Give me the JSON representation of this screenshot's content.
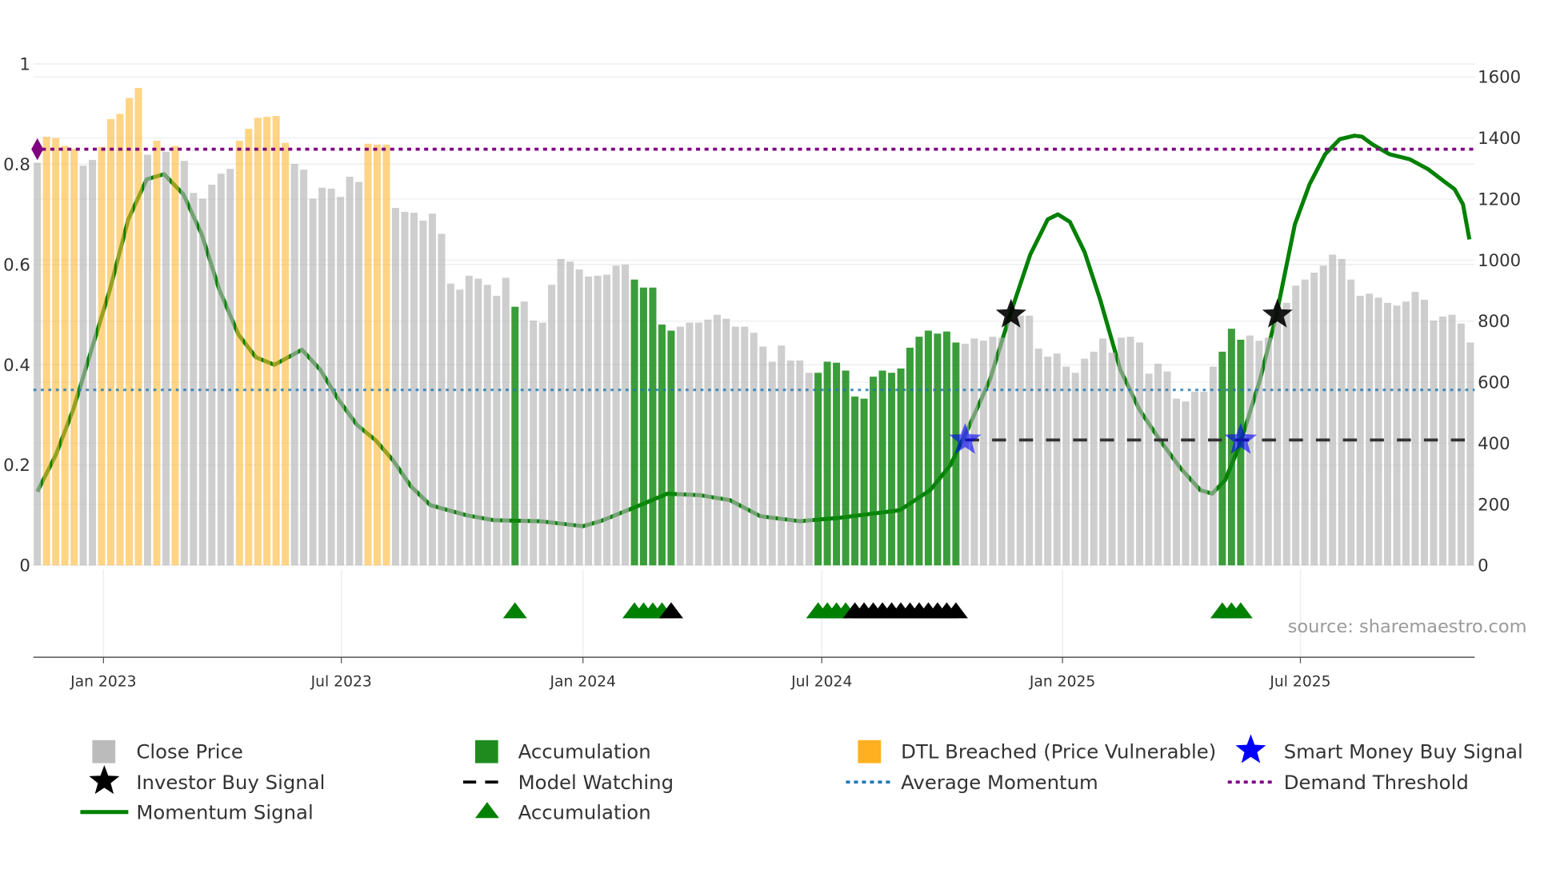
{
  "chart_data": {
    "type": "bar",
    "title": "",
    "left_axis": {
      "label": "",
      "range": [
        0,
        1
      ],
      "ticks": [
        "0",
        "0.2",
        "0.4",
        "0.6",
        "0.8",
        "1"
      ],
      "tick_values": [
        0,
        0.2,
        0.4,
        0.6,
        0.8,
        1
      ]
    },
    "right_axis": {
      "label": "",
      "range": [
        0,
        1600
      ],
      "ticks": [
        "0",
        "200",
        "400",
        "600",
        "800",
        "1000",
        "1200",
        "1400",
        "1600"
      ],
      "tick_values": [
        0,
        200,
        400,
        600,
        800,
        1000,
        1200,
        1400,
        1600
      ]
    },
    "x_axis": {
      "unit": "week index",
      "ticks": [
        {
          "label": "Jan 2023",
          "week": 7.2
        },
        {
          "label": "Jul 2023",
          "week": 33.1
        },
        {
          "label": "Jan 2024",
          "week": 59.4
        },
        {
          "label": "Jul 2024",
          "week": 85.4
        },
        {
          "label": "Jan 2025",
          "week": 111.6
        },
        {
          "label": "Jul 2025",
          "week": 137.5
        }
      ]
    },
    "close_price": [
      1319,
      1404,
      1400,
      1374,
      1364,
      1309,
      1328,
      1371,
      1462,
      1479,
      1531,
      1564,
      1345,
      1391,
      1355,
      1374,
      1325,
      1220,
      1201,
      1247,
      1283,
      1299,
      1391,
      1430,
      1466,
      1469,
      1472,
      1384,
      1315,
      1296,
      1201,
      1237,
      1234,
      1207,
      1273,
      1256,
      1381,
      1378,
      1378,
      1171,
      1158,
      1155,
      1129,
      1152,
      1086,
      923,
      903,
      949,
      939,
      919,
      883,
      942,
      847,
      864,
      802,
      795,
      919,
      1004,
      995,
      969,
      946,
      949,
      952,
      982,
      985,
      936,
      910,
      910,
      789,
      769,
      782,
      795,
      795,
      805,
      821,
      808,
      782,
      782,
      762,
      717,
      667,
      720,
      671,
      671,
      631,
      631,
      667,
      664,
      638,
      553,
      546,
      618,
      638,
      631,
      645,
      713,
      749,
      769,
      759,
      766,
      730,
      726,
      743,
      736,
      749,
      746,
      808,
      818,
      818,
      710,
      684,
      694,
      651,
      631,
      677,
      700,
      743,
      697,
      746,
      749,
      730,
      628,
      661,
      635,
      546,
      537,
      569,
      569,
      651,
      700,
      775,
      739,
      753,
      736,
      746,
      851,
      860,
      916,
      936,
      959,
      982,
      1018,
      1004,
      936,
      883,
      890,
      877,
      860,
      851,
      864,
      896,
      870,
      802,
      815,
      821,
      792,
      730
    ],
    "bar_state_runs": [
      [
        "C",
        1
      ],
      [
        "D",
        4
      ],
      [
        "C",
        2
      ],
      [
        "D",
        5
      ],
      [
        "C",
        1
      ],
      [
        "D",
        1
      ],
      [
        "C",
        1
      ],
      [
        "D",
        1
      ],
      [
        "C",
        6
      ],
      [
        "D",
        6
      ],
      [
        "C",
        8
      ],
      [
        "D",
        3
      ],
      [
        "C",
        13
      ],
      [
        "A",
        1
      ],
      [
        "C",
        12
      ],
      [
        "A",
        5
      ],
      [
        "C",
        15
      ],
      [
        "A",
        16
      ],
      [
        "C",
        28
      ],
      [
        "A",
        3
      ],
      [
        "C",
        25
      ]
    ],
    "momentum": [
      [
        0,
        0.147
      ],
      [
        2,
        0.22
      ],
      [
        3.9,
        0.31
      ],
      [
        5.9,
        0.43
      ],
      [
        7.9,
        0.55
      ],
      [
        9.9,
        0.69
      ],
      [
        11.9,
        0.77
      ],
      [
        13.8,
        0.78
      ],
      [
        15.9,
        0.74
      ],
      [
        17.9,
        0.66
      ],
      [
        19.8,
        0.55
      ],
      [
        21.9,
        0.46
      ],
      [
        23.8,
        0.415
      ],
      [
        25.8,
        0.4
      ],
      [
        27.8,
        0.42
      ],
      [
        28.8,
        0.43
      ],
      [
        30.8,
        0.39
      ],
      [
        32.8,
        0.33
      ],
      [
        34.8,
        0.28
      ],
      [
        36.8,
        0.25
      ],
      [
        38.7,
        0.21
      ],
      [
        40.7,
        0.157
      ],
      [
        42.8,
        0.12
      ],
      [
        46.7,
        0.1
      ],
      [
        49.7,
        0.09
      ],
      [
        54.7,
        0.088
      ],
      [
        59.4,
        0.078
      ],
      [
        61.3,
        0.088
      ],
      [
        65.6,
        0.12
      ],
      [
        68.6,
        0.143
      ],
      [
        72.1,
        0.14
      ],
      [
        75.4,
        0.13
      ],
      [
        78.7,
        0.098
      ],
      [
        83,
        0.088
      ],
      [
        87.4,
        0.095
      ],
      [
        93.9,
        0.11
      ],
      [
        97.2,
        0.15
      ],
      [
        99.4,
        0.2
      ],
      [
        101.5,
        0.28
      ],
      [
        103.7,
        0.37
      ],
      [
        105.9,
        0.5
      ],
      [
        108.1,
        0.62
      ],
      [
        110,
        0.69
      ],
      [
        111.1,
        0.7
      ],
      [
        112.4,
        0.685
      ],
      [
        114,
        0.625
      ],
      [
        115.7,
        0.53
      ],
      [
        117.9,
        0.39
      ],
      [
        120,
        0.31
      ],
      [
        122.2,
        0.25
      ],
      [
        124.4,
        0.195
      ],
      [
        126.6,
        0.15
      ],
      [
        127.9,
        0.143
      ],
      [
        129.3,
        0.17
      ],
      [
        130.9,
        0.24
      ],
      [
        133.1,
        0.37
      ],
      [
        134.9,
        0.5
      ],
      [
        136.9,
        0.68
      ],
      [
        138.5,
        0.76
      ],
      [
        140.2,
        0.82
      ],
      [
        141.8,
        0.85
      ],
      [
        143.4,
        0.857
      ],
      [
        144.2,
        0.855
      ],
      [
        145.3,
        0.84
      ],
      [
        147.2,
        0.82
      ],
      [
        149.4,
        0.81
      ],
      [
        151.4,
        0.79
      ],
      [
        153.2,
        0.765
      ],
      [
        154.3,
        0.75
      ],
      [
        155.2,
        0.72
      ],
      [
        155.9,
        0.65
      ]
    ],
    "average_momentum": 0.35,
    "demand_threshold": 0.83,
    "model_watching": {
      "level": 0.25,
      "from_week": 101,
      "to_week": 156
    },
    "smart_money_buy_signals": [
      {
        "week": 101,
        "value": 0.25
      },
      {
        "week": 131,
        "value": 0.25
      }
    ],
    "investor_buy_signals": [
      {
        "week": 106,
        "value": 0.5
      },
      {
        "week": 135,
        "value": 0.5
      }
    ],
    "accumulation_triangles_green": [
      52,
      65,
      66,
      67,
      68,
      85,
      86,
      87,
      88,
      129,
      130,
      131
    ],
    "accumulation_triangles_black": [
      69,
      89,
      90,
      91,
      92,
      93,
      94,
      95,
      96,
      97,
      98,
      99,
      100
    ],
    "legend_placement": "bottom"
  },
  "colors": {
    "close": "#b4b4b4",
    "accumulation": "#0f870f",
    "dtl": "#ffb733",
    "momentum": "#008000",
    "average": "#1f77b4",
    "threshold": "#800080",
    "smart_money": "#0000ff",
    "investor": "#000000"
  },
  "source": "source: sharemaestro.com",
  "legend": {
    "close_price": "Close Price",
    "accumulation": "Accumulation",
    "dtl": "DTL Breached (Price Vulnerable)",
    "smart_money": "Smart Money Buy Signal",
    "investor": "Investor Buy Signal",
    "model_watching": "Model Watching",
    "average_momentum": "Average Momentum",
    "demand_threshold": "Demand Threshold",
    "momentum_signal": "Momentum Signal",
    "accumulation_triangle": "Accumulation"
  }
}
